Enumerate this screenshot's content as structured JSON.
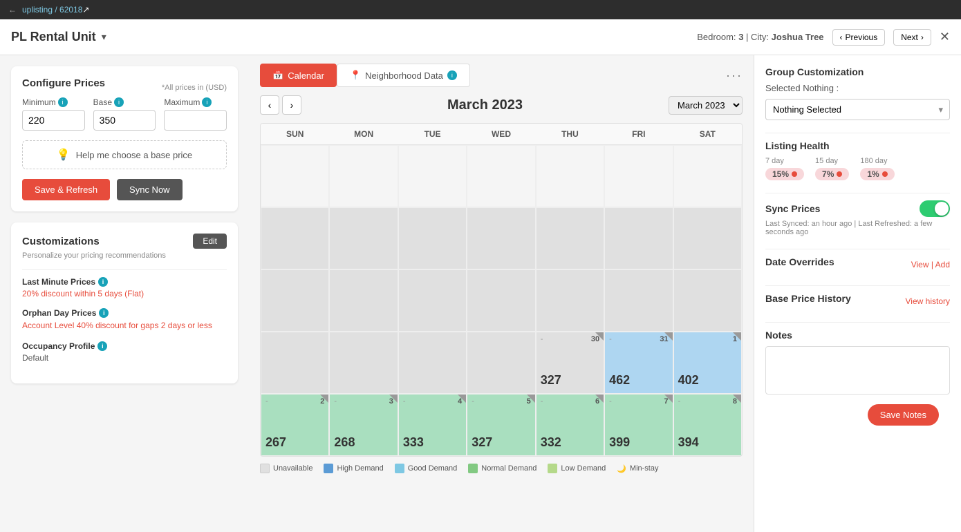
{
  "topbar": {
    "link_text": "uplisting / 62018",
    "link_icon": "↗"
  },
  "header": {
    "title": "PL Rental Unit",
    "dropdown_icon": "▾",
    "bedroom_label": "Bedroom:",
    "bedroom_value": "3",
    "city_label": "City:",
    "city_value": "Joshua Tree",
    "prev_label": "Previous",
    "next_label": "Next",
    "close_icon": "✕"
  },
  "configure_prices": {
    "title": "Configure Prices",
    "subtitle": "*All prices in (USD)",
    "minimum_label": "Minimum",
    "base_label": "Base",
    "maximum_label": "Maximum",
    "minimum_value": "220",
    "base_value": "350",
    "maximum_value": "",
    "help_label": "Help me choose a base price",
    "save_label": "Save & Refresh",
    "sync_label": "Sync Now"
  },
  "customizations": {
    "title": "Customizations",
    "desc": "Personalize your pricing recommendations",
    "edit_label": "Edit",
    "last_minute_title": "Last Minute Prices",
    "last_minute_value": "20% discount within 5 days (Flat)",
    "orphan_day_title": "Orphan Day Prices",
    "orphan_day_value": "Account Level 40% discount for gaps 2 days or less",
    "occupancy_title": "Occupancy Profile",
    "occupancy_value": "Default"
  },
  "tabs": {
    "calendar_label": "Calendar",
    "neighborhood_label": "Neighborhood Data"
  },
  "calendar": {
    "title": "March 2023",
    "month_select": "March 2023",
    "days": [
      "SUN",
      "MON",
      "TUE",
      "WED",
      "THU",
      "FRI",
      "SAT"
    ],
    "cells": [
      {
        "type": "empty",
        "date": "",
        "price": ""
      },
      {
        "type": "empty",
        "date": "",
        "price": ""
      },
      {
        "type": "empty",
        "date": "",
        "price": ""
      },
      {
        "type": "empty",
        "date": "",
        "price": ""
      },
      {
        "type": "empty",
        "date": "",
        "price": ""
      },
      {
        "type": "empty",
        "date": "",
        "price": ""
      },
      {
        "type": "empty",
        "date": "",
        "price": ""
      },
      {
        "type": "gray",
        "date": "",
        "price": ""
      },
      {
        "type": "gray",
        "date": "",
        "price": ""
      },
      {
        "type": "gray",
        "date": "",
        "price": ""
      },
      {
        "type": "gray",
        "date": "",
        "price": ""
      },
      {
        "type": "gray",
        "date": "",
        "price": ""
      },
      {
        "type": "gray",
        "date": "",
        "price": ""
      },
      {
        "type": "gray",
        "date": "",
        "price": ""
      },
      {
        "type": "gray",
        "date": "",
        "price": ""
      },
      {
        "type": "gray",
        "date": "",
        "price": ""
      },
      {
        "type": "gray",
        "date": "",
        "price": ""
      },
      {
        "type": "gray",
        "date": "",
        "price": ""
      },
      {
        "type": "gray",
        "date": "",
        "price": ""
      },
      {
        "type": "gray",
        "date": "",
        "price": ""
      },
      {
        "type": "gray",
        "date": "",
        "price": ""
      },
      {
        "type": "gray",
        "date": "",
        "price": ""
      },
      {
        "type": "gray",
        "date": "",
        "price": ""
      },
      {
        "type": "gray",
        "date": "",
        "price": ""
      },
      {
        "type": "gray",
        "date": "",
        "price": ""
      },
      {
        "type": "gray",
        "date": "30",
        "price": "327",
        "dash": "-",
        "triangle": true
      },
      {
        "type": "light-blue",
        "date": "31",
        "price": "462",
        "dash": "-",
        "triangle": true
      },
      {
        "type": "light-blue",
        "date": "1",
        "price": "402",
        "triangle": true
      },
      {
        "type": "green",
        "date": "2",
        "price": "267",
        "dash": "-",
        "triangle": true
      },
      {
        "type": "green",
        "date": "3",
        "price": "268",
        "dash": "-",
        "triangle": true
      },
      {
        "type": "green",
        "date": "4",
        "price": "333",
        "dash": "-",
        "triangle": true
      },
      {
        "type": "green",
        "date": "5",
        "price": "327",
        "dash": "-",
        "triangle": true
      },
      {
        "type": "green",
        "date": "6",
        "price": "332",
        "dash": "-",
        "triangle": true
      },
      {
        "type": "green",
        "date": "7",
        "price": "399",
        "dash": "-",
        "triangle": true
      },
      {
        "type": "green",
        "date": "8",
        "price": "394",
        "dash": "-",
        "triangle": true
      }
    ]
  },
  "legend": [
    {
      "label": "Unavailable",
      "type": "unavail"
    },
    {
      "label": "High Demand",
      "type": "high"
    },
    {
      "label": "Good Demand",
      "type": "good"
    },
    {
      "label": "Normal Demand",
      "type": "normal"
    },
    {
      "label": "Low Demand",
      "type": "low"
    },
    {
      "label": "Min-stay",
      "type": "min"
    }
  ],
  "right_panel": {
    "group_title": "Group Customization",
    "selected_label": "Selected Nothing :",
    "group_placeholder": "Nothing Selected",
    "health_title": "Listing Health",
    "health_7_label": "7 day",
    "health_7_value": "15%",
    "health_15_label": "15 day",
    "health_15_value": "7%",
    "health_180_label": "180 day",
    "health_180_value": "1%",
    "sync_title": "Sync Prices",
    "sync_meta": "Last Synced: an hour ago | Last Refreshed: a few seconds ago",
    "date_overrides_title": "Date Overrides",
    "date_overrides_links": "View | Add",
    "base_history_title": "Base Price History",
    "base_history_link": "View history",
    "notes_title": "Notes",
    "save_notes_label": "Save Notes"
  }
}
